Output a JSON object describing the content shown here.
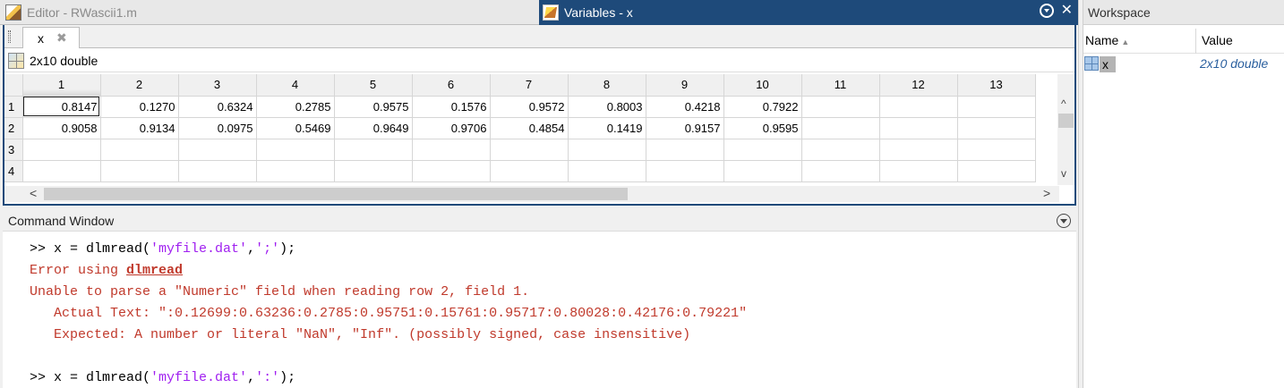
{
  "titlebar": {
    "editor_tab": "Editor - RWascii1.m",
    "variables_tab": "Variables - x",
    "close_glyph": "✕"
  },
  "variable_editor": {
    "tab_label": "x",
    "tab_close": "✖",
    "info": "2x10 double",
    "columns": [
      "1",
      "2",
      "3",
      "4",
      "5",
      "6",
      "7",
      "8",
      "9",
      "10",
      "11",
      "12",
      "13"
    ],
    "rows": [
      {
        "label": "1",
        "cells": [
          "0.8147",
          "0.1270",
          "0.6324",
          "0.2785",
          "0.9575",
          "0.1576",
          "0.9572",
          "0.8003",
          "0.4218",
          "0.7922",
          "",
          "",
          ""
        ]
      },
      {
        "label": "2",
        "cells": [
          "0.9058",
          "0.9134",
          "0.0975",
          "0.5469",
          "0.9649",
          "0.9706",
          "0.4854",
          "0.1419",
          "0.9157",
          "0.9595",
          "",
          "",
          ""
        ]
      },
      {
        "label": "3",
        "cells": [
          "",
          "",
          "",
          "",
          "",
          "",
          "",
          "",
          "",
          "",
          "",
          "",
          ""
        ]
      },
      {
        "label": "4",
        "cells": [
          "",
          "",
          "",
          "",
          "",
          "",
          "",
          "",
          "",
          "",
          "",
          "",
          ""
        ]
      }
    ],
    "scroll_up": "^",
    "scroll_down": "v",
    "scroll_left": "<",
    "scroll_right": ">"
  },
  "command_window": {
    "title": "Command Window",
    "lines": {
      "l1_prompt": ">> x = dlmread(",
      "l1_arg1": "'myfile.dat'",
      "l1_comma": ",",
      "l1_arg2": "';'",
      "l1_end": ");",
      "l2_text": "Error using ",
      "l2_link": "dlmread",
      "l3": "Unable to parse a \"Numeric\" field when reading row 2, field 1.",
      "l4": "   Actual Text: \":0.12699:0.63236:0.2785:0.95751:0.15761:0.95717:0.80028:0.42176:0.79221\"",
      "l5": "   Expected: A number or literal \"NaN\", \"Inf\". (possibly signed, case insensitive)",
      "l7_prompt": ">> x = dlmread(",
      "l7_arg1": "'myfile.dat'",
      "l7_comma": ",",
      "l7_arg2": "':'",
      "l7_end": ");"
    }
  },
  "workspace": {
    "title": "Workspace",
    "col_name": "Name",
    "col_value": "Value",
    "sort_glyph": "▲",
    "variables": [
      {
        "name": "x",
        "value": "2x10 double"
      }
    ]
  },
  "colors": {
    "active_title": "#1e4a7a",
    "error": "#c0392b",
    "string": "#a020f0",
    "workspace_value": "#2a5f9e"
  }
}
